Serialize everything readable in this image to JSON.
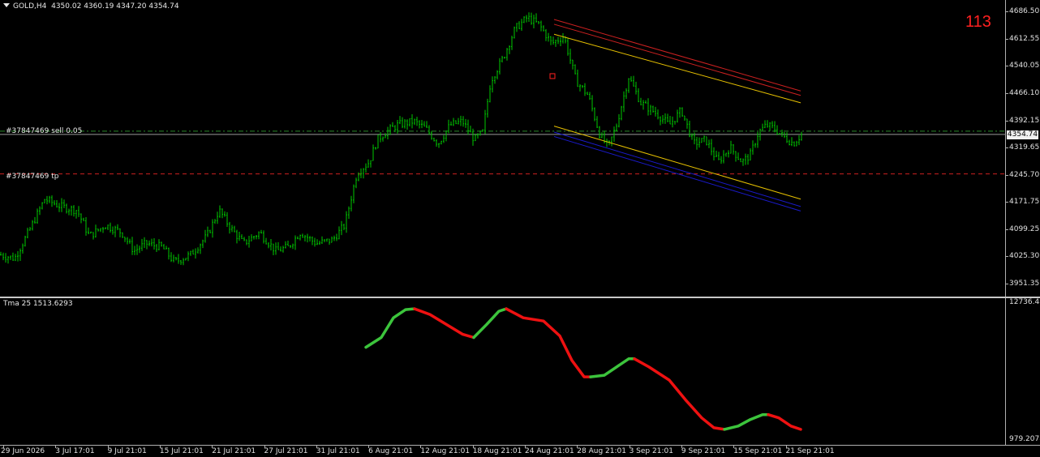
{
  "header": {
    "symbol": "GOLD,H4",
    "open": "4350.02",
    "high": "4360.19",
    "low": "4347.20",
    "close": "4354.74",
    "counter": "113"
  },
  "trade_lines": {
    "sell_label": "#37847469 sell 0.05",
    "tp_label": "#37847469 tp"
  },
  "bid_price": "4354.74",
  "indicator": {
    "label": "Tma 25 1513.6293",
    "max_label": "12736.481",
    "min_label": "979.2078"
  },
  "colors": {
    "candles": "#00c800",
    "bid_line": "#9a9a9a",
    "sell_line": "#2a8a2a",
    "tp_line": "#cc2020",
    "channel_upper": [
      "#cc2020",
      "#cc2020",
      "#e6c000"
    ],
    "channel_lower": [
      "#e6c000",
      "#1a1acc",
      "#1a1acc"
    ],
    "tma_up": "#3cc43c",
    "tma_down": "#ee1111"
  },
  "chart_data": [
    {
      "type": "candlestick",
      "symbol": "GOLD",
      "timeframe": "H4",
      "y_ticks": [
        "4686.50",
        "4612.55",
        "4540.05",
        "4466.10",
        "4392.15",
        "4319.65",
        "4245.70",
        "4171.75",
        "4099.25",
        "4025.30",
        "3951.35"
      ],
      "x_ticks": [
        "29 Jun 2026",
        "3 Jul 17:01",
        "9 Jul 21:01",
        "15 Jul 21:01",
        "21 Jul 21:01",
        "27 Jul 21:01",
        "31 Jul 21:01",
        "6 Aug 21:01",
        "12 Aug 21:01",
        "18 Aug 21:01",
        "24 Aug 21:01",
        "28 Aug 21:01",
        "3 Sep 21:01",
        "9 Sep 21:01",
        "15 Sep 21:01",
        "21 Sep 21:01"
      ],
      "ylim": [
        3930,
        4700
      ],
      "price_path": [
        [
          0,
          4030
        ],
        [
          18,
          4020
        ],
        [
          35,
          4090
        ],
        [
          55,
          4180
        ],
        [
          75,
          4160
        ],
        [
          95,
          4150
        ],
        [
          110,
          4080
        ],
        [
          130,
          4110
        ],
        [
          150,
          4090
        ],
        [
          165,
          4040
        ],
        [
          180,
          4060
        ],
        [
          200,
          4050
        ],
        [
          215,
          4010
        ],
        [
          235,
          4030
        ],
        [
          255,
          4080
        ],
        [
          270,
          4150
        ],
        [
          285,
          4100
        ],
        [
          300,
          4060
        ],
        [
          320,
          4090
        ],
        [
          340,
          4040
        ],
        [
          355,
          4050
        ],
        [
          370,
          4090
        ],
        [
          390,
          4060
        ],
        [
          410,
          4070
        ],
        [
          425,
          4110
        ],
        [
          440,
          4250
        ],
        [
          455,
          4280
        ],
        [
          465,
          4340
        ],
        [
          475,
          4360
        ],
        [
          490,
          4380
        ],
        [
          510,
          4390
        ],
        [
          525,
          4370
        ],
        [
          540,
          4330
        ],
        [
          555,
          4380
        ],
        [
          570,
          4390
        ],
        [
          585,
          4340
        ],
        [
          595,
          4360
        ],
        [
          605,
          4500
        ],
        [
          620,
          4560
        ],
        [
          635,
          4640
        ],
        [
          650,
          4670
        ],
        [
          665,
          4650
        ],
        [
          680,
          4600
        ],
        [
          695,
          4620
        ],
        [
          710,
          4500
        ],
        [
          725,
          4460
        ],
        [
          740,
          4350
        ],
        [
          750,
          4320
        ],
        [
          760,
          4380
        ],
        [
          775,
          4510
        ],
        [
          790,
          4440
        ],
        [
          810,
          4410
        ],
        [
          825,
          4380
        ],
        [
          840,
          4420
        ],
        [
          855,
          4330
        ],
        [
          870,
          4340
        ],
        [
          885,
          4280
        ],
        [
          900,
          4320
        ],
        [
          915,
          4280
        ],
        [
          925,
          4300
        ],
        [
          935,
          4360
        ],
        [
          945,
          4380
        ],
        [
          955,
          4370
        ],
        [
          965,
          4350
        ],
        [
          978,
          4330
        ],
        [
          988,
          4354.74
        ]
      ],
      "sell_price": 4363.5,
      "tp_price": 4248,
      "bid": 4354.74,
      "channel_lines": [
        {
          "color": "red",
          "start": [
            683,
            4665
          ],
          "end": [
            987,
            4472
          ]
        },
        {
          "color": "red",
          "start": [
            683,
            4652
          ],
          "end": [
            987,
            4460
          ]
        },
        {
          "color": "yellow",
          "start": [
            683,
            4625
          ],
          "end": [
            987,
            4440
          ]
        },
        {
          "color": "yellow",
          "start": [
            683,
            4377
          ],
          "end": [
            987,
            4180
          ]
        },
        {
          "color": "blue",
          "start": [
            683,
            4361
          ],
          "end": [
            987,
            4160
          ]
        },
        {
          "color": "blue",
          "start": [
            683,
            4349
          ],
          "end": [
            987,
            4148
          ]
        }
      ],
      "marker": {
        "x": 681,
        "price": 4512,
        "color": "red"
      }
    },
    {
      "type": "line",
      "name": "Tma 25",
      "ylim": [
        979.2078,
        12736.481
      ],
      "segments": [
        {
          "color": "up",
          "points": [
            [
              451,
              12500
            ],
            [
              470,
              12560
            ],
            [
              485,
              12680
            ],
            [
              500,
              12730
            ],
            [
              511,
              12735
            ]
          ]
        },
        {
          "color": "down",
          "points": [
            [
              511,
              12735
            ],
            [
              530,
              12700
            ],
            [
              550,
              12640
            ],
            [
              570,
              12580
            ],
            [
              584,
              12560
            ]
          ]
        },
        {
          "color": "up",
          "points": [
            [
              584,
              12560
            ],
            [
              600,
              12640
            ],
            [
              615,
              12720
            ],
            [
              624,
              12735
            ]
          ]
        },
        {
          "color": "down",
          "points": [
            [
              624,
              12735
            ],
            [
              645,
              12680
            ],
            [
              670,
              12660
            ],
            [
              690,
              12570
            ],
            [
              705,
              12420
            ],
            [
              720,
              12320
            ],
            [
              728,
              12320
            ]
          ]
        },
        {
          "color": "up",
          "points": [
            [
              728,
              12320
            ],
            [
              745,
              12330
            ],
            [
              760,
              12380
            ],
            [
              775,
              12430
            ],
            [
              782,
              12430
            ]
          ]
        },
        {
          "color": "down",
          "points": [
            [
              782,
              12430
            ],
            [
              800,
              12380
            ],
            [
              825,
              12300
            ],
            [
              845,
              12180
            ],
            [
              865,
              12070
            ],
            [
              880,
              12010
            ],
            [
              893,
              12000
            ]
          ]
        },
        {
          "color": "up",
          "points": [
            [
              893,
              12000
            ],
            [
              910,
              12020
            ],
            [
              925,
              12060
            ],
            [
              940,
              12090
            ],
            [
              947,
              12090
            ]
          ]
        },
        {
          "color": "down",
          "points": [
            [
              947,
              12090
            ],
            [
              960,
              12070
            ],
            [
              975,
              12020
            ],
            [
              987,
              12000
            ]
          ]
        }
      ]
    }
  ]
}
